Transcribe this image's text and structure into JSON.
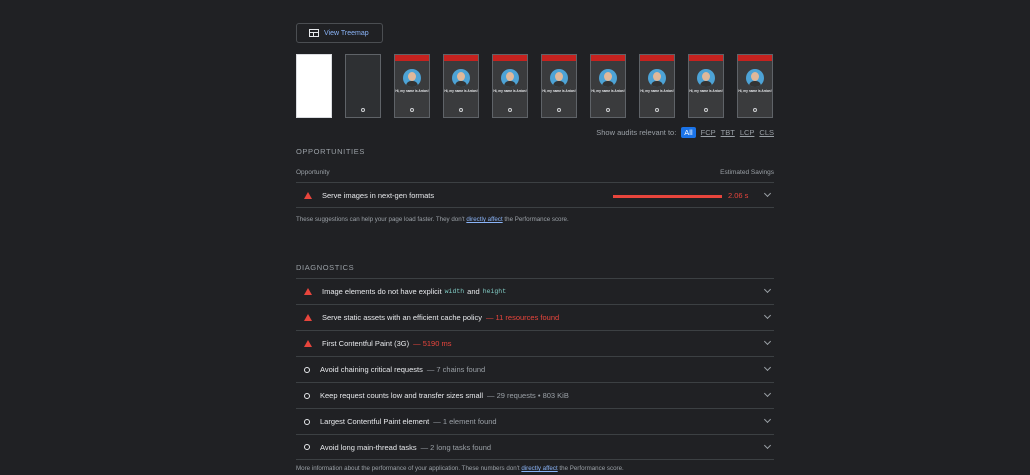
{
  "toolbar": {
    "treemap_label": "View Treemap"
  },
  "filmstrip": {
    "caption": "Hi, my name is Anton!"
  },
  "filter": {
    "label": "Show audits relevant to:",
    "options": [
      "All",
      "FCP",
      "TBT",
      "LCP",
      "CLS"
    ],
    "selected": "All"
  },
  "opportunities": {
    "title": "OPPORTUNITIES",
    "col_left": "Opportunity",
    "col_right": "Estimated Savings",
    "items": [
      {
        "label": "Serve images in next-gen formats",
        "savings": "2.06 s",
        "savings_fraction": 0.85
      }
    ],
    "note_before": "These suggestions can help your page load faster. They don't",
    "note_link": "directly affect",
    "note_after": "the Performance score."
  },
  "diagnostics": {
    "title": "DIAGNOSTICS",
    "items": [
      {
        "pre": "Image elements do not have explicit",
        "code1": "width",
        "mid": "and",
        "code2": "height",
        "status": "fail"
      },
      {
        "label": "Serve static assets with an efficient cache policy",
        "detail": "— 11 resources found",
        "status": "fail"
      },
      {
        "label": "First Contentful Paint (3G)",
        "detail": "— 5190 ms",
        "status": "fail"
      },
      {
        "label": "Avoid chaining critical requests",
        "detail": "— 7 chains found",
        "status": "info"
      },
      {
        "label": "Keep request counts low and transfer sizes small",
        "detail": "— 29 requests • 803 KiB",
        "status": "info"
      },
      {
        "label": "Largest Contentful Paint element",
        "detail": "— 1 element found",
        "status": "info"
      },
      {
        "label": "Avoid long main-thread tasks",
        "detail": "— 2 long tasks found",
        "status": "info"
      }
    ],
    "note_before": "More information about the performance of your application. These numbers don't",
    "note_link": "directly affect",
    "note_after": "the Performance score."
  },
  "colors": {
    "fail": "#e8453c",
    "link": "#8ab4f8",
    "accent": "#1a73e8"
  }
}
